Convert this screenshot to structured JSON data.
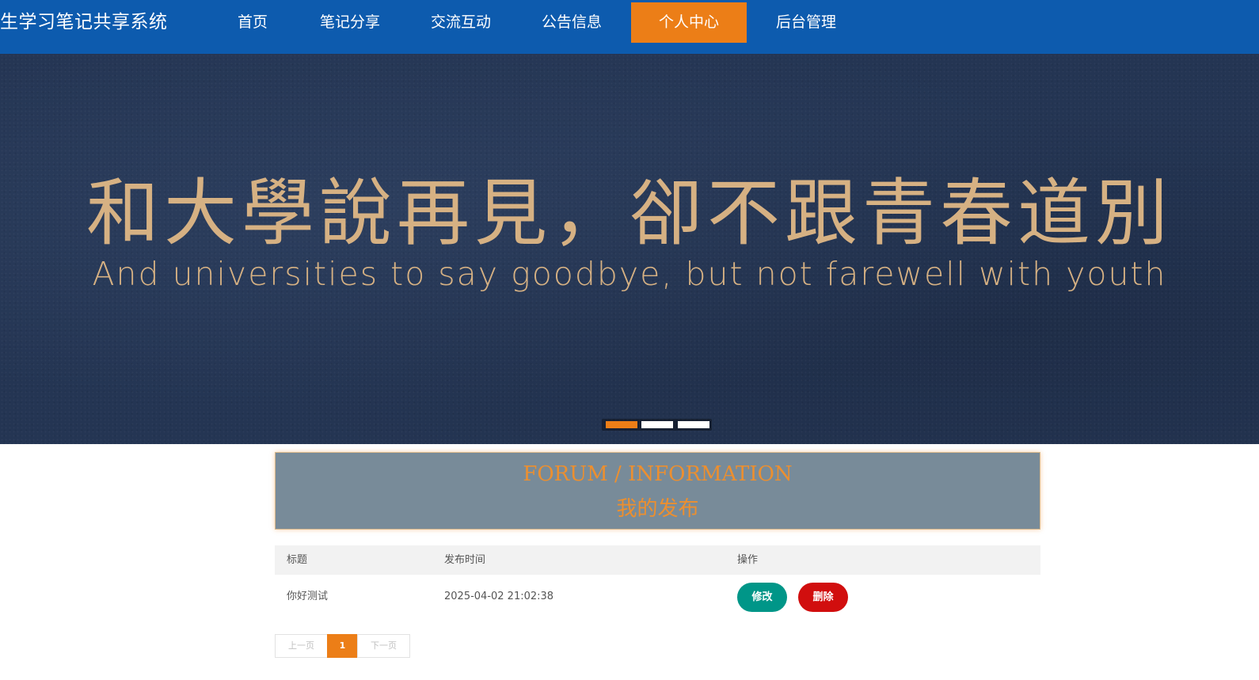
{
  "header": {
    "brand": "生学习笔记共享系统",
    "nav": [
      {
        "label": "首页",
        "active": false
      },
      {
        "label": "笔记分享",
        "active": false
      },
      {
        "label": "交流互动",
        "active": false
      },
      {
        "label": "公告信息",
        "active": false
      },
      {
        "label": "个人中心",
        "active": true
      },
      {
        "label": "后台管理",
        "active": false
      }
    ]
  },
  "banner": {
    "title_cn": "和大學說再見，卻不跟青春道別",
    "title_en": "And universities to say goodbye, but not farewell with youth",
    "indicators": [
      {
        "active": true
      },
      {
        "active": false
      },
      {
        "active": false
      }
    ]
  },
  "section": {
    "title_en": "FORUM / INFORMATION",
    "title_cn": "我的发布"
  },
  "table": {
    "headers": [
      "标题",
      "发布时间",
      "操作"
    ],
    "rows": [
      {
        "title": "你好测试",
        "time": "2025-04-02 21:02:38",
        "edit_label": "修改",
        "delete_label": "删除"
      }
    ]
  },
  "pagination": {
    "prev_label": "上一页",
    "current": "1",
    "next_label": "下一页"
  },
  "colors": {
    "nav_bg": "#0d5bae",
    "accent": "#ec7e17",
    "edit_button": "#009688",
    "delete_button": "#d10e0e",
    "section_bg": "#788b99"
  }
}
